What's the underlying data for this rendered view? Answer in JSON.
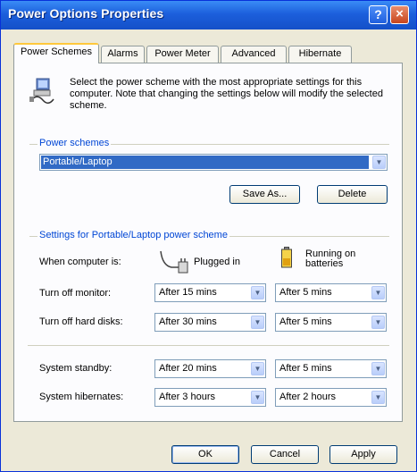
{
  "window": {
    "title": "Power Options Properties"
  },
  "titlebar": {
    "help_icon": "?",
    "close_icon": "×"
  },
  "tabs": [
    {
      "label": "Power Schemes",
      "active": true
    },
    {
      "label": "Alarms",
      "active": false
    },
    {
      "label": "Power Meter",
      "active": false
    },
    {
      "label": "Advanced",
      "active": false
    },
    {
      "label": "Hibernate",
      "active": false
    }
  ],
  "description": "Select the power scheme with the most appropriate settings for this computer. Note that changing the settings below will modify the selected scheme.",
  "power_schemes": {
    "group_label": "Power schemes",
    "selected": "Portable/Laptop",
    "save_as_label": "Save As...",
    "delete_label": "Delete"
  },
  "settings": {
    "group_label": "Settings for Portable/Laptop power scheme",
    "when_label": "When computer is:",
    "plugged_in_label": "Plugged in",
    "batteries_label": "Running on batteries",
    "rows": [
      {
        "label": "Turn off monitor:",
        "plugged": "After 15 mins",
        "battery": "After 5 mins"
      },
      {
        "label": "Turn off hard disks:",
        "plugged": "After 30 mins",
        "battery": "After 5 mins"
      },
      {
        "label": "System standby:",
        "plugged": "After 20 mins",
        "battery": "After 5 mins"
      },
      {
        "label": "System hibernates:",
        "plugged": "After 3 hours",
        "battery": "After 2 hours"
      }
    ]
  },
  "buttons": {
    "ok": "OK",
    "cancel": "Cancel",
    "apply": "Apply"
  },
  "colors": {
    "title_blue": "#1c5fdc",
    "group_label_blue": "#0046d5",
    "selection_blue": "#316ac5",
    "dialog_bg": "#ece9d8"
  }
}
